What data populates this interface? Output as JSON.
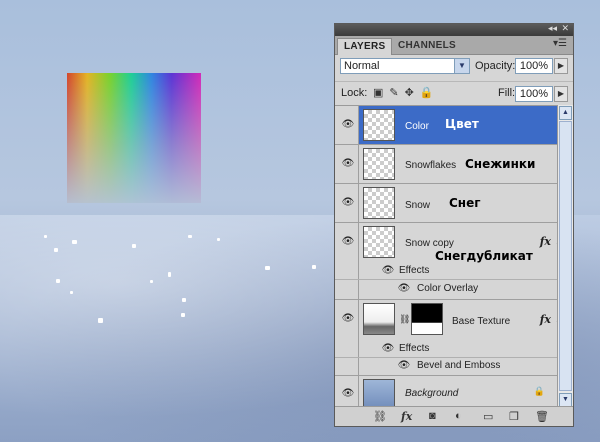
{
  "panel": {
    "tabs": [
      "LAYERS",
      "CHANNELS"
    ],
    "blend_mode": "Normal",
    "opacity_label": "Opacity:",
    "opacity_value": "100%",
    "lock_label": "Lock:",
    "fill_label": "Fill:",
    "fill_value": "100%"
  },
  "layers": [
    {
      "name": "Color",
      "annotation": "Цвет",
      "selected": true
    },
    {
      "name": "Snowflakes",
      "annotation": "Снежинки"
    },
    {
      "name": "Snow",
      "annotation": "Снег"
    },
    {
      "name": "Snow copy",
      "annotation": "Снегдубликат",
      "effects_label": "Effects",
      "effect": "Color Overlay"
    },
    {
      "name": "Base Texture",
      "effects_label": "Effects",
      "effect": "Bevel and Emboss"
    },
    {
      "name": "Background"
    }
  ],
  "colors": {
    "selection": "#3c6bc7",
    "panel": "#d6d6d6"
  }
}
